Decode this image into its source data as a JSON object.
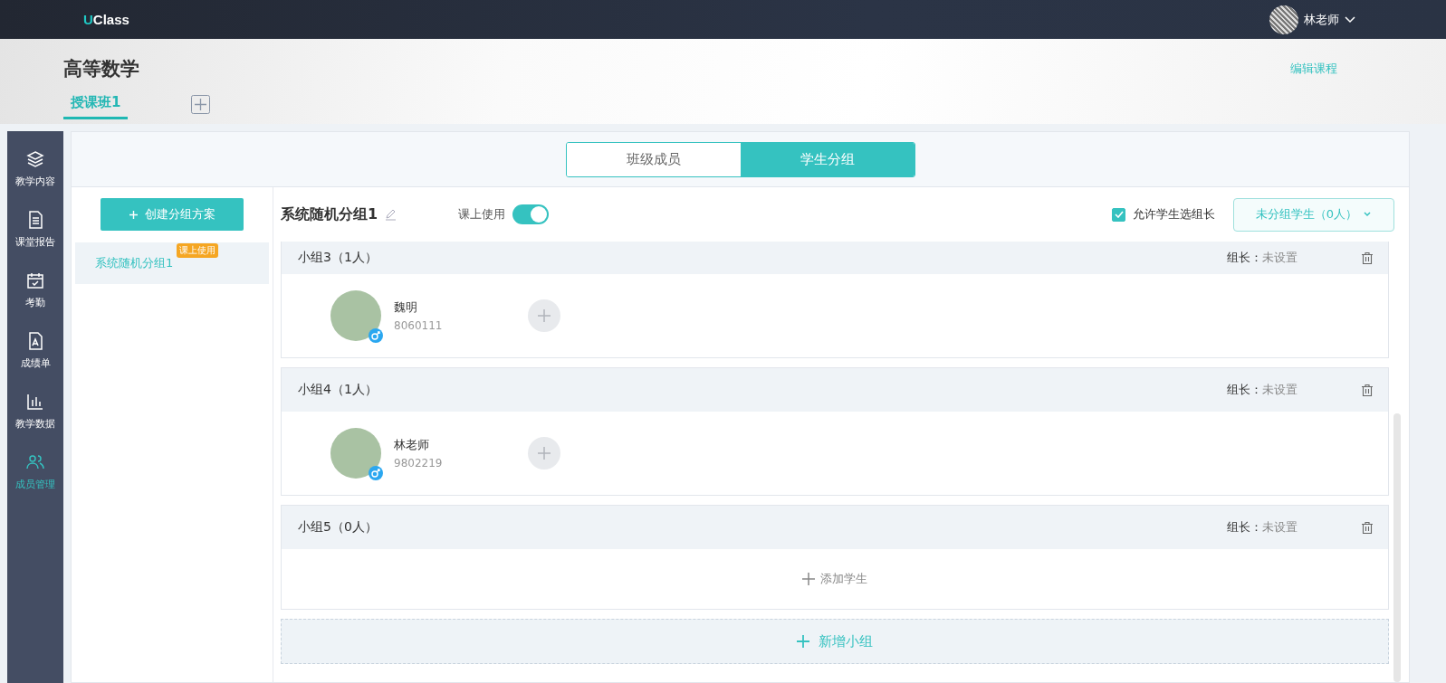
{
  "topbar": {
    "logo": "UClass",
    "user": "林老师"
  },
  "course": {
    "title": "高等数学",
    "edit_link": "编辑课程",
    "class_tabs": [
      {
        "label": "授课班1",
        "selected": true
      }
    ]
  },
  "sidebar": {
    "items": [
      {
        "label": "教学内容",
        "selected": false
      },
      {
        "label": "课堂报告",
        "selected": false
      },
      {
        "label": "考勤",
        "selected": false
      },
      {
        "label": "成绩单",
        "selected": false
      },
      {
        "label": "教学数据",
        "selected": false
      },
      {
        "label": "成员管理",
        "selected": true
      }
    ]
  },
  "segments": [
    {
      "label": "班级成员",
      "selected": false
    },
    {
      "label": "学生分组",
      "selected": true
    }
  ],
  "plans": {
    "create_button": "创建分组方案",
    "items": [
      {
        "name": "系统随机分组1",
        "badge": "课上使用",
        "selected": true
      }
    ]
  },
  "plan": {
    "title": "系统随机分组1",
    "in_class_label": "课上使用",
    "in_class_on": true,
    "allow_leader_label": "允许学生选组长",
    "allow_leader_checked": true,
    "ungrouped_button": "未分组学生（0人）"
  },
  "groups": [
    {
      "title": "小组3（1人）",
      "leader_label": "组长：",
      "leader_value": "未设置",
      "students": [
        {
          "name": "魏明",
          "id": "8060111"
        }
      ]
    },
    {
      "title": "小组4（1人）",
      "leader_label": "组长：",
      "leader_value": "未设置",
      "students": [
        {
          "name": "林老师",
          "id": "9802219"
        }
      ]
    },
    {
      "title": "小组5（0人）",
      "leader_label": "组长：",
      "leader_value": "未设置",
      "add_student": "添加学生"
    }
  ],
  "add_group": "新增小组"
}
